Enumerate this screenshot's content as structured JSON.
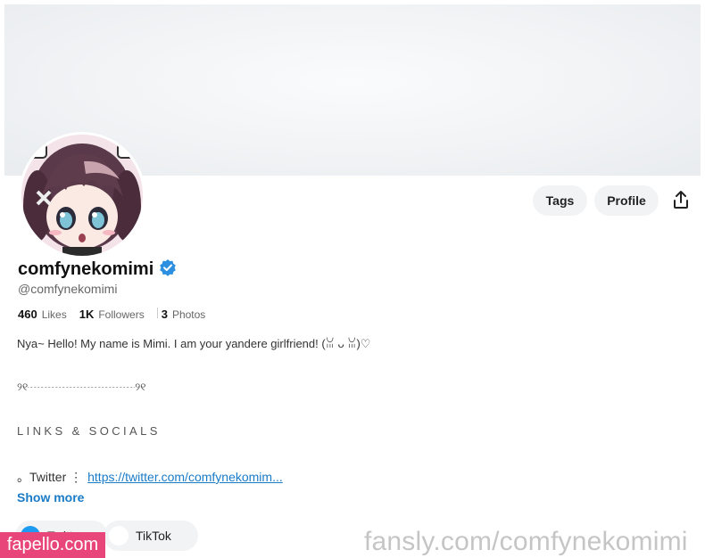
{
  "profile": {
    "display_name": "comfynekomimi",
    "handle": "@comfynekomimi",
    "verified_icon": "verified-badge-icon",
    "avatar_icon": "anime-girl-avatar"
  },
  "actions": {
    "tags_label": "Tags",
    "profile_label": "Profile",
    "share_icon": "share-icon"
  },
  "stats": [
    {
      "value": "460",
      "label": "Likes"
    },
    {
      "value": "1K",
      "label": "Followers"
    },
    {
      "value": "3",
      "label": "Photos"
    }
  ],
  "bio": {
    "line1": "Nya~ Hello! My name is Mimi. I am your yandere girlfriend! (ꈍ ᴗ ꈍ)♡",
    "divider": "୨୧┈┈┈┈┈┈┈┈┈┈୨୧",
    "links_title": "LINKS & SOCIALS",
    "link_bullet": "。Twitter ⋮",
    "link_url": "https://twitter.com/comfynekomim..."
  },
  "show_more_label": "Show more",
  "social_chips": [
    {
      "label": "Twitter",
      "icon": "twitter-icon"
    },
    {
      "label": "TikTok",
      "icon": "tiktok-icon"
    }
  ],
  "watermarks": {
    "left": "fapello.com",
    "right": "fansly.com/comfynekomimi"
  },
  "colors": {
    "accent": "#1a7bc7",
    "verified": "#2d8fe0",
    "watermark_pink": "#e8457a"
  }
}
